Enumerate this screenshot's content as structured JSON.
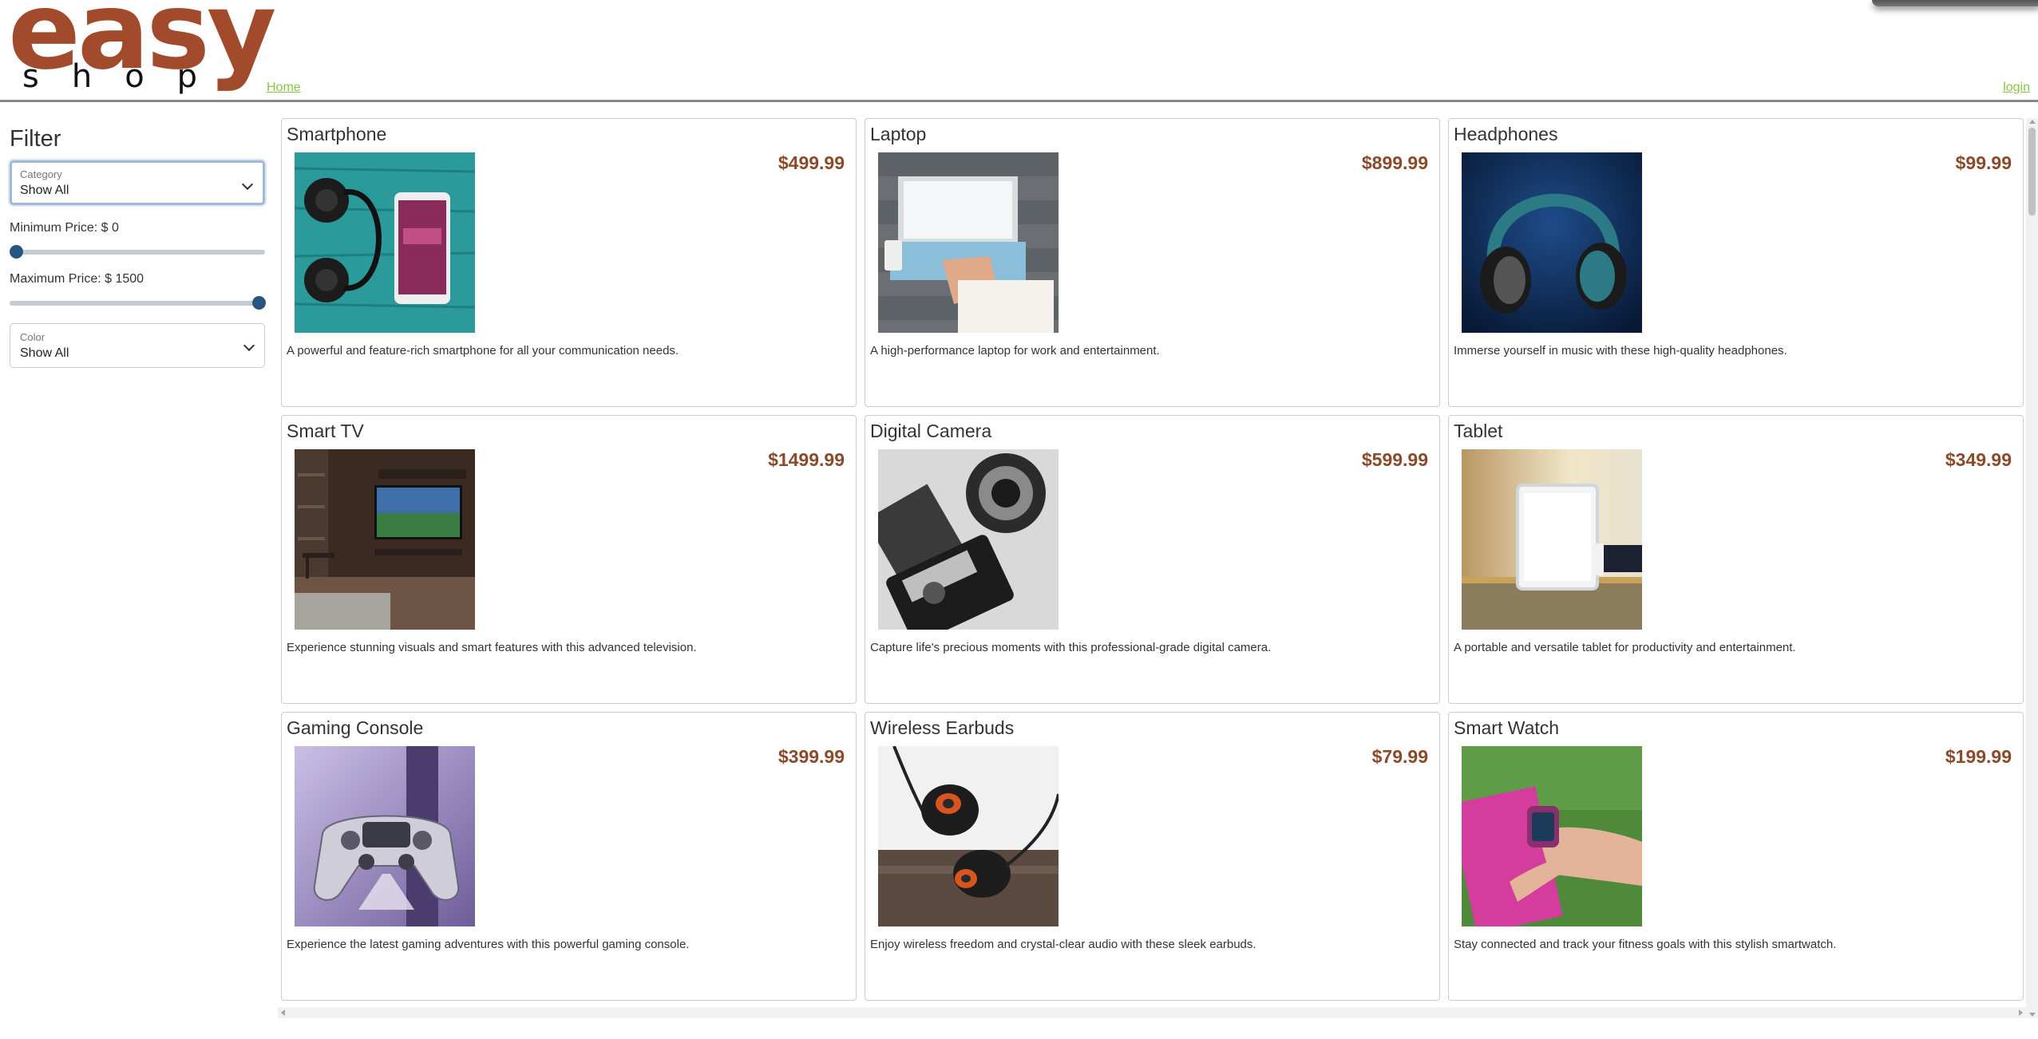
{
  "header": {
    "logo_top": "easy",
    "logo_bottom": "shop",
    "home_link": "Home",
    "login_link": "login"
  },
  "filter": {
    "title": "Filter",
    "category": {
      "label": "Category",
      "value": "Show All"
    },
    "min_price_label": "Minimum Price: $ 0",
    "max_price_label": "Maximum Price: $ 1500",
    "min_price": 0,
    "max_price": 1500,
    "price_range": [
      0,
      1500
    ],
    "color": {
      "label": "Color",
      "value": "Show All"
    }
  },
  "products": [
    {
      "name": "Smartphone",
      "price": "$499.99",
      "description": "A powerful and feature-rich smartphone for all your communication needs.",
      "image": "smartphone-photo"
    },
    {
      "name": "Laptop",
      "price": "$899.99",
      "description": "A high-performance laptop for work and entertainment.",
      "image": "laptop-photo"
    },
    {
      "name": "Headphones",
      "price": "$99.99",
      "description": "Immerse yourself in music with these high-quality headphones.",
      "image": "headphones-photo"
    },
    {
      "name": "Smart TV",
      "price": "$1499.99",
      "description": "Experience stunning visuals and smart features with this advanced television.",
      "image": "smart-tv-photo"
    },
    {
      "name": "Digital Camera",
      "price": "$599.99",
      "description": "Capture life's precious moments with this professional-grade digital camera.",
      "image": "camera-photo"
    },
    {
      "name": "Tablet",
      "price": "$349.99",
      "description": "A portable and versatile tablet for productivity and entertainment.",
      "image": "tablet-photo"
    },
    {
      "name": "Gaming Console",
      "price": "$399.99",
      "description": "Experience the latest gaming adventures with this powerful gaming console.",
      "image": "controller-photo"
    },
    {
      "name": "Wireless Earbuds",
      "price": "$79.99",
      "description": "Enjoy wireless freedom and crystal-clear audio with these sleek earbuds.",
      "image": "earbuds-photo"
    },
    {
      "name": "Smart Watch",
      "price": "$199.99",
      "description": "Stay connected and track your fitness goals with this stylish smartwatch.",
      "image": "smartwatch-photo"
    }
  ],
  "colors": {
    "brand": "#a24a2c",
    "link": "#8bc34a",
    "price": "#8b4a2a",
    "slider": "#27577f"
  }
}
